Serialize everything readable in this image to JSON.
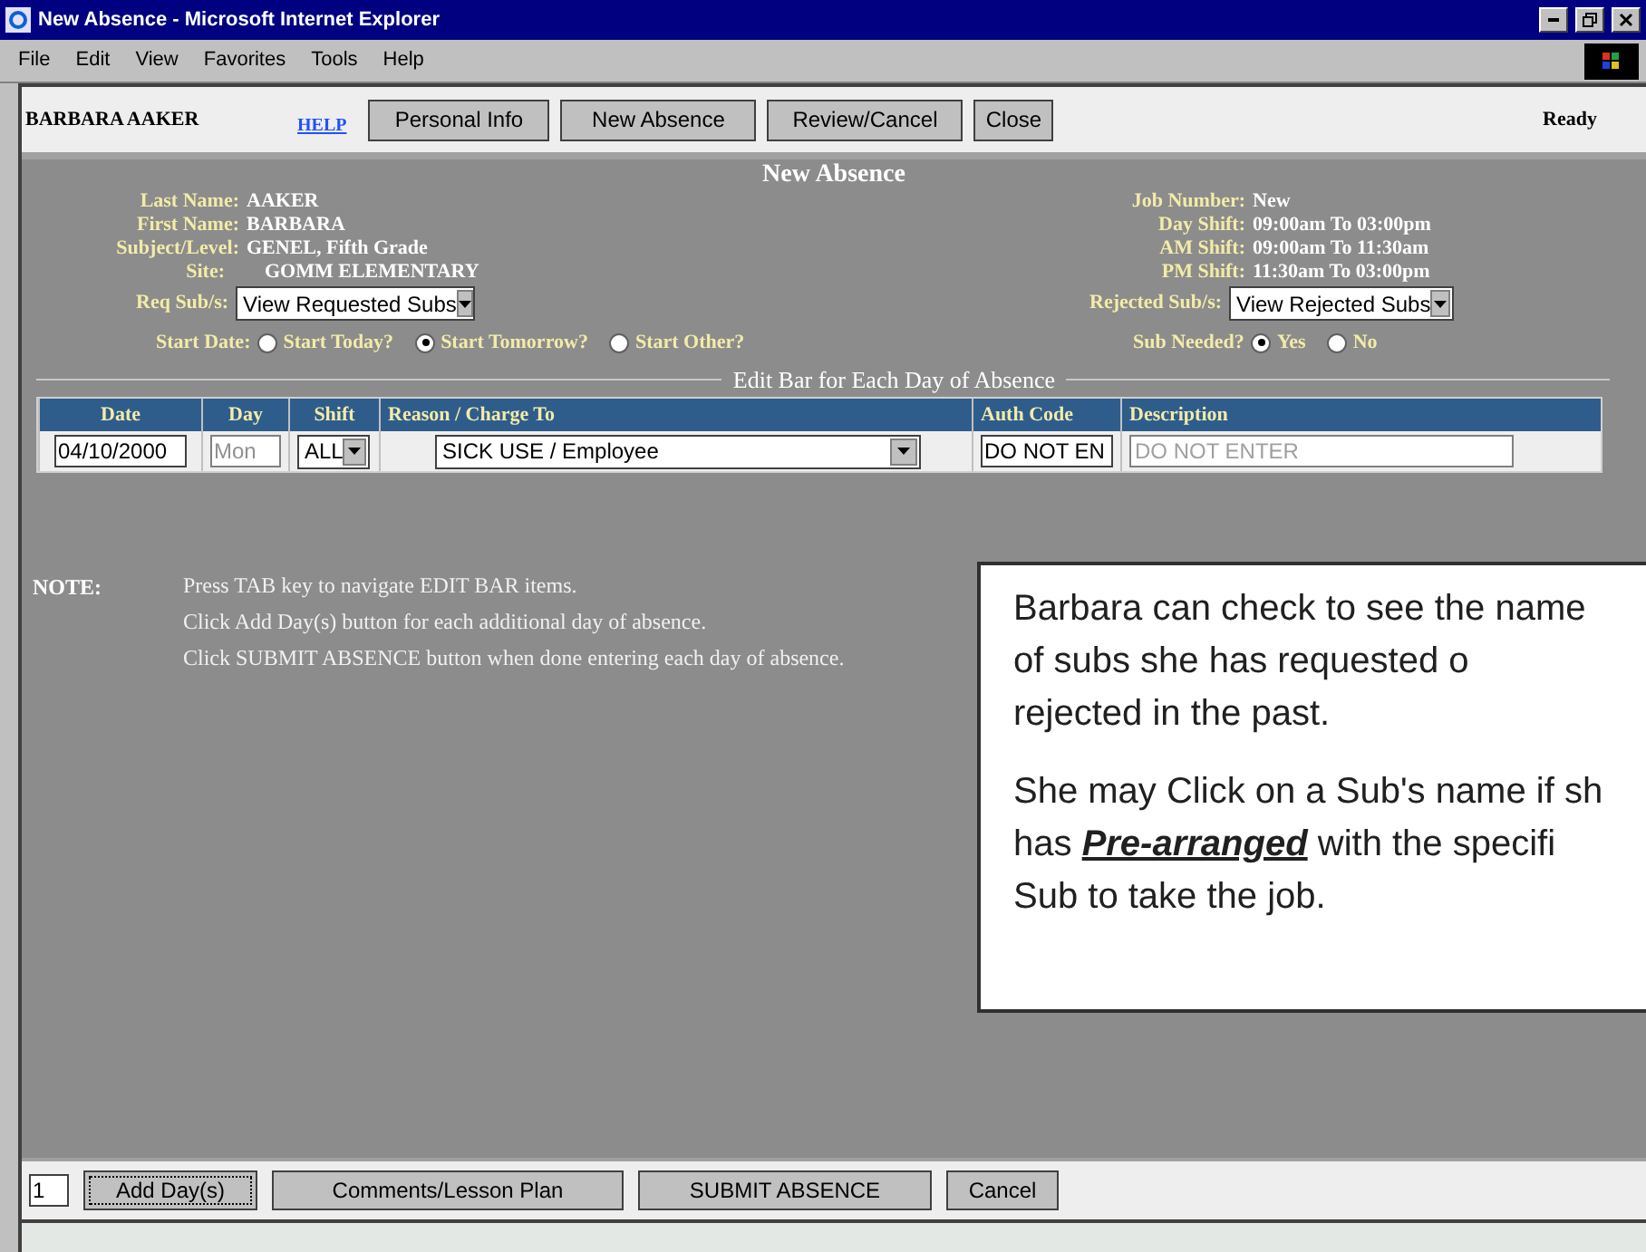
{
  "window": {
    "title": "New Absence - Microsoft Internet Explorer"
  },
  "menu": [
    "File",
    "Edit",
    "View",
    "Favorites",
    "Tools",
    "Help"
  ],
  "toolbar": {
    "user": "BARBARA AAKER",
    "help_link": "HELP",
    "buttons": [
      "Personal Info",
      "New Absence",
      "Review/Cancel",
      "Close"
    ],
    "status": "Ready"
  },
  "page_title": "New Absence",
  "left_fields": [
    {
      "label": "Last Name:",
      "value": "AAKER"
    },
    {
      "label": "First Name:",
      "value": "BARBARA"
    },
    {
      "label": "Subject/Level:",
      "value": "GENEL, Fifth Grade"
    },
    {
      "label": "Site:",
      "value": "GOMM ELEMENTARY"
    }
  ],
  "right_fields": [
    {
      "label": "Job Number:",
      "value": "New"
    },
    {
      "label": "Day Shift:",
      "value": "09:00am To 03:00pm"
    },
    {
      "label": "AM Shift:",
      "value": "09:00am To 11:30am"
    },
    {
      "label": "PM Shift:",
      "value": "11:30am To 03:00pm"
    }
  ],
  "req_subs": {
    "label": "Req Sub/s:",
    "value": "View Requested Subs"
  },
  "rejected_subs": {
    "label": "Rejected Sub/s:",
    "value": "View Rejected Subs"
  },
  "start_date": {
    "label": "Start Date:",
    "options": [
      {
        "label": "Start Today?",
        "selected": false
      },
      {
        "label": "Start Tomorrow?",
        "selected": true
      },
      {
        "label": "Start Other?",
        "selected": false
      }
    ]
  },
  "sub_needed": {
    "label": "Sub Needed?",
    "options": [
      {
        "label": "Yes",
        "selected": true
      },
      {
        "label": "No",
        "selected": false
      }
    ]
  },
  "edit_bar": {
    "title": "Edit Bar for Each Day of Absence",
    "columns": [
      "Date",
      "Day",
      "Shift",
      "Reason / Charge To",
      "Auth Code",
      "Description"
    ],
    "row": {
      "date": "04/10/2000",
      "day": "Mon",
      "shift": "ALL",
      "reason": "SICK USE / Employee",
      "auth_code": "DO NOT EN",
      "description_placeholder": "DO NOT ENTER"
    }
  },
  "note": {
    "label": "NOTE:",
    "lines": [
      "Press TAB key to navigate EDIT BAR items.",
      "Click Add Day(s) button for each additional day of absence.",
      "Click SUBMIT ABSENCE button when done entering each day of absence."
    ]
  },
  "callout": {
    "paragraphs": [
      [
        "Barbara can check to see the name",
        "of subs she has requested o",
        "rejected in the past."
      ],
      [
        "She may Click on a Sub's name if sh",
        "has **Pre-arranged** with the specifi",
        "Sub to take the job."
      ]
    ]
  },
  "bottom": {
    "days": "1",
    "buttons": [
      "Add Day(s)",
      "Comments/Lesson Plan",
      "SUBMIT ABSENCE",
      "Cancel"
    ]
  }
}
